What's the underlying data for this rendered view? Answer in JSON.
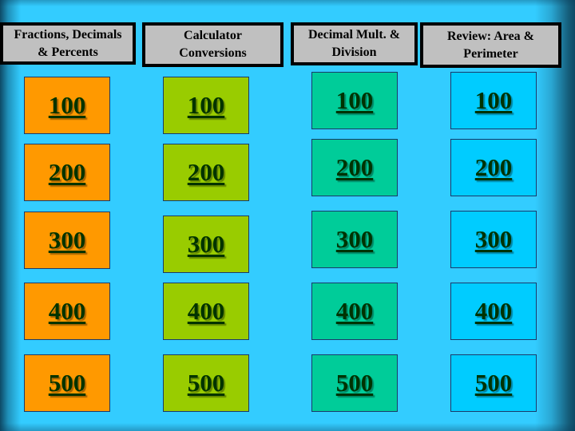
{
  "colors": {
    "background": "#33ccff",
    "header": "#c0c0c0",
    "text": "#003300"
  },
  "categories": [
    {
      "title": "Fractions, Decimals\n& Percents",
      "color": "#ff9900",
      "values": [
        "100",
        "200",
        "300",
        "400",
        "500"
      ]
    },
    {
      "title": "Calculator\nConversions",
      "color": "#99cc00",
      "values": [
        "100",
        "200",
        "300",
        "400",
        "500"
      ]
    },
    {
      "title": "Decimal Mult. &\nDivision",
      "color": "#00cc99",
      "values": [
        "100",
        "200",
        "300",
        "400",
        "500"
      ]
    },
    {
      "title": "Review: Area &\nPerimeter",
      "color": "#00ccff",
      "values": [
        "100",
        "200",
        "300",
        "400",
        "500"
      ]
    }
  ]
}
